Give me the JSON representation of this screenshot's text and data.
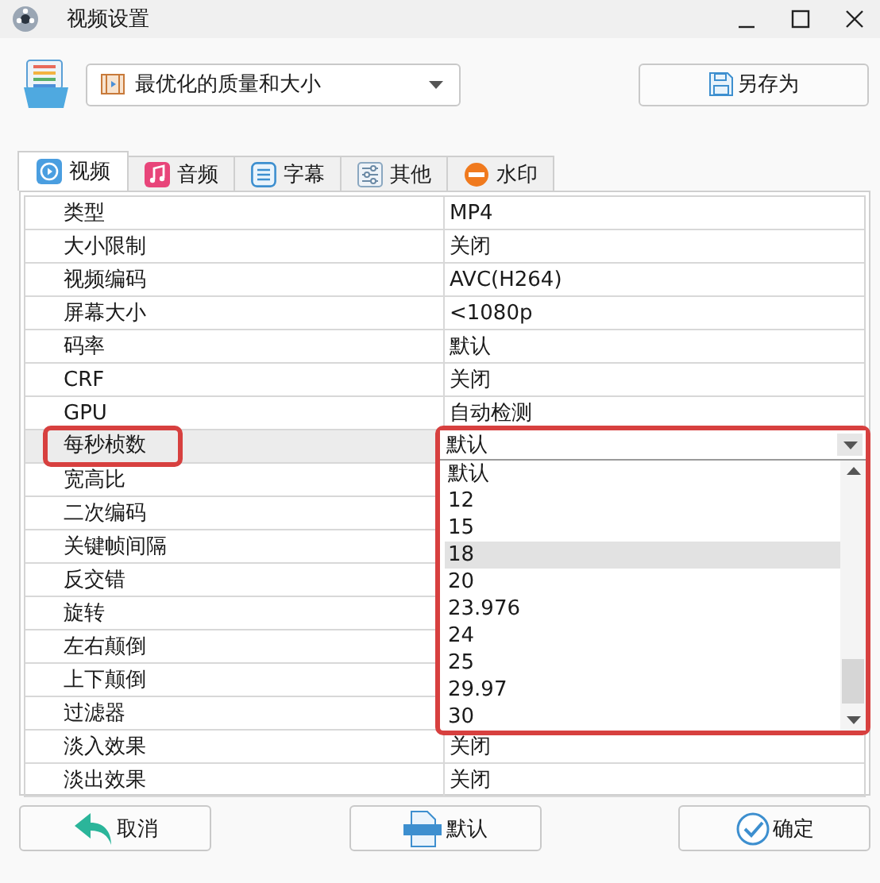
{
  "window": {
    "title": "视频设置"
  },
  "preset": {
    "value": "最优化的质量和大小"
  },
  "save_as_button": {
    "label": "另存为"
  },
  "tabs": [
    {
      "label": "视频",
      "selected": true
    },
    {
      "label": "音频",
      "selected": false
    },
    {
      "label": "字幕",
      "selected": false
    },
    {
      "label": "其他",
      "selected": false
    },
    {
      "label": "水印",
      "selected": false
    }
  ],
  "properties": [
    {
      "name": "类型",
      "value": "MP4",
      "selected": false
    },
    {
      "name": "大小限制",
      "value": "关闭",
      "selected": false
    },
    {
      "name": "视频编码",
      "value": "AVC(H264)",
      "selected": false
    },
    {
      "name": "屏幕大小",
      "value": "<1080p",
      "selected": false
    },
    {
      "name": "码率",
      "value": "默认",
      "selected": false
    },
    {
      "name": "CRF",
      "value": "关闭",
      "selected": false
    },
    {
      "name": "GPU",
      "value": "自动检测",
      "selected": false
    },
    {
      "name": "每秒桢数",
      "value": "默认",
      "selected": true,
      "dropdown": {
        "options": [
          {
            "label": "默认",
            "selected": false
          },
          {
            "label": "12",
            "selected": false
          },
          {
            "label": "15",
            "selected": false
          },
          {
            "label": "18",
            "selected": true
          },
          {
            "label": "20",
            "selected": false
          },
          {
            "label": "23.976",
            "selected": false
          },
          {
            "label": "24",
            "selected": false
          },
          {
            "label": "25",
            "selected": false
          },
          {
            "label": "29.97",
            "selected": false
          },
          {
            "label": "30",
            "selected": false
          }
        ]
      }
    },
    {
      "name": "宽高比",
      "selected": false
    },
    {
      "name": "二次编码",
      "selected": false
    },
    {
      "name": "关键帧间隔",
      "selected": false
    },
    {
      "name": "反交错",
      "selected": false
    },
    {
      "name": "旋转",
      "selected": false
    },
    {
      "name": "左右颠倒",
      "selected": false
    },
    {
      "name": "上下颠倒",
      "selected": false
    },
    {
      "name": "过滤器",
      "selected": false
    },
    {
      "name": "淡入效果",
      "value": "关闭",
      "selected": false
    },
    {
      "name": "淡出效果",
      "value": "关闭",
      "selected": false
    }
  ],
  "buttons": [
    {
      "label": "取消"
    },
    {
      "label": "默认"
    },
    {
      "label": "确定"
    }
  ]
}
